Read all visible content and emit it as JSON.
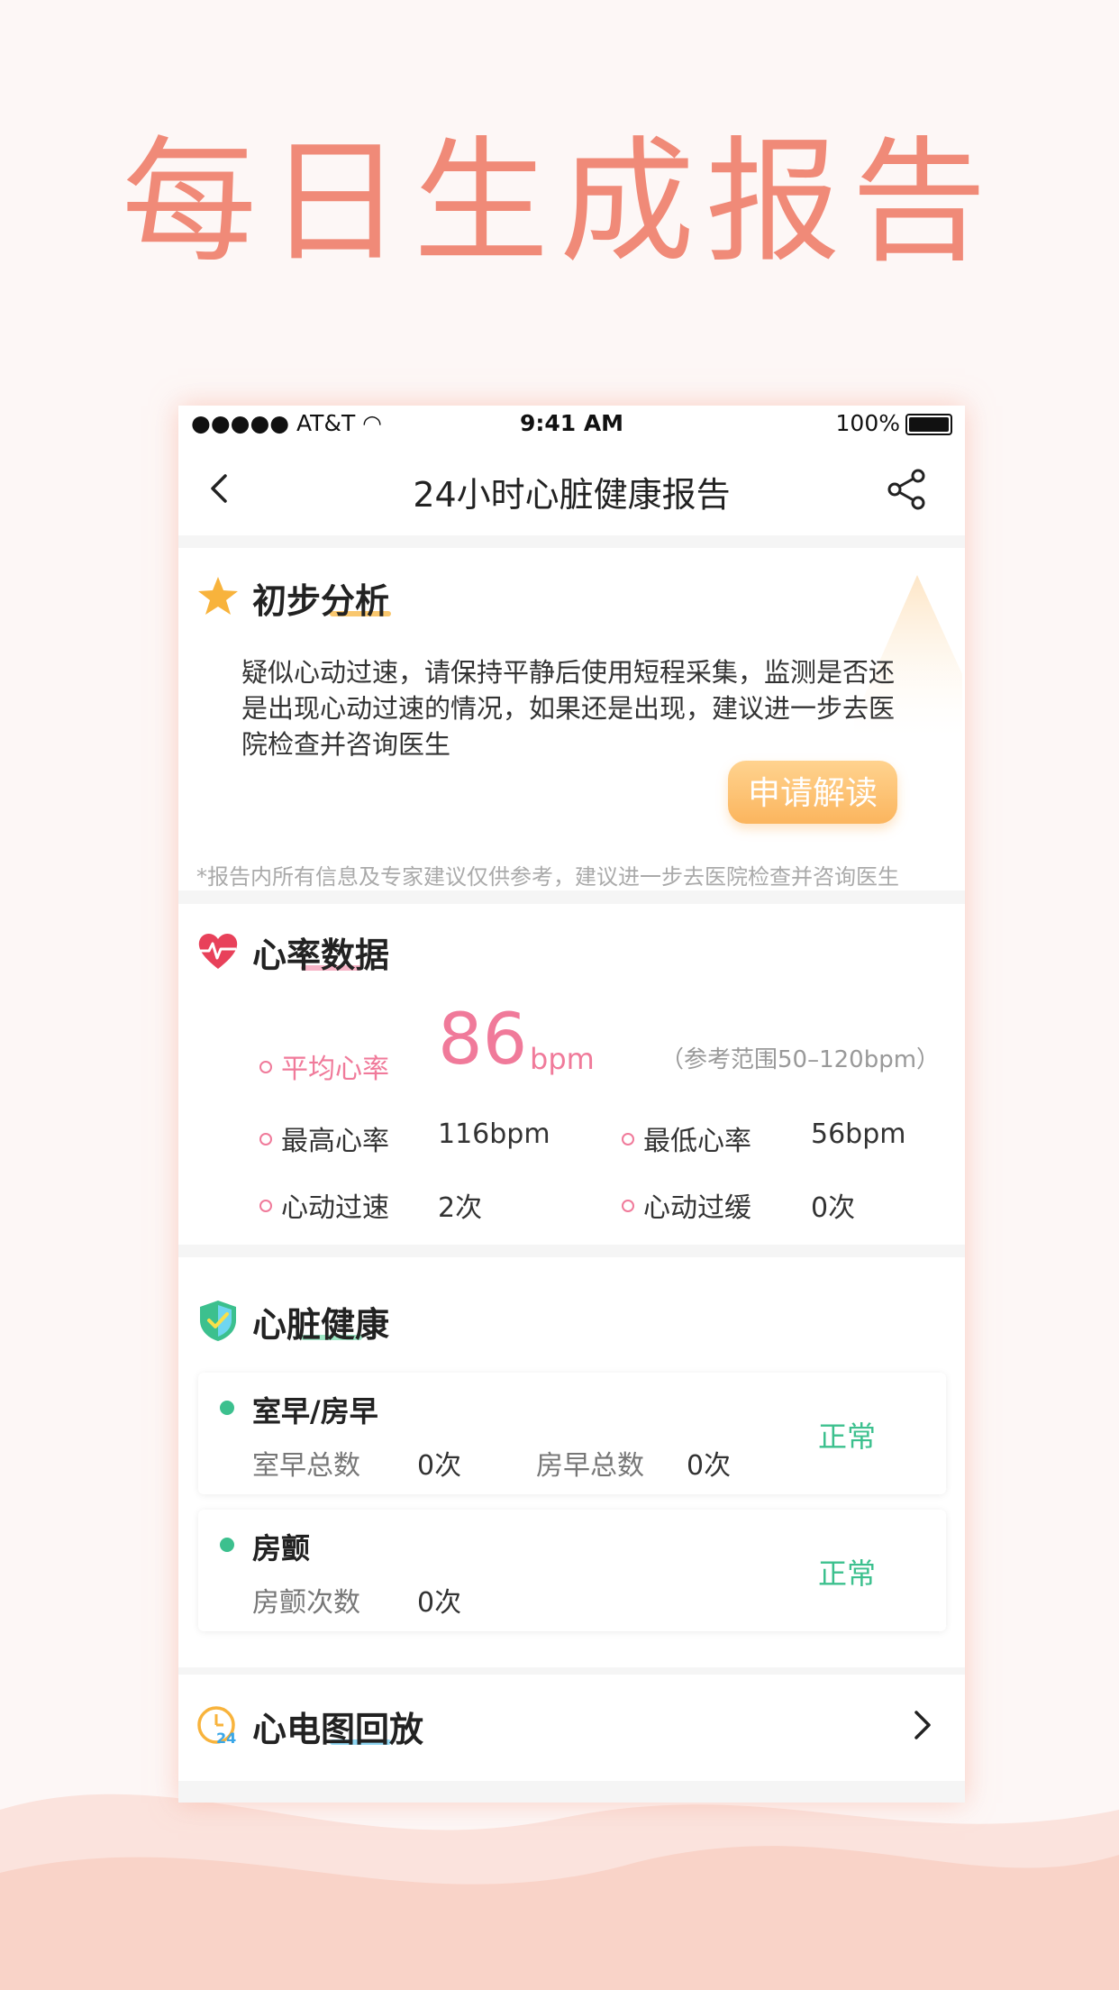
{
  "headline": "每日生成报告",
  "status_bar": {
    "carrier": "●●●●● AT&T",
    "time": "9:41 AM",
    "battery": "100%"
  },
  "nav": {
    "title": "24小时心脏健康报告",
    "back_icon": "chevron-left-icon",
    "share_icon": "share-icon"
  },
  "analysis": {
    "title": "初步分析",
    "text": "疑似心动过速，请保持平静后使用短程采集，监测是否还是出现心动过速的情况，如果还是出现，建议进一步去医院检查并咨询医生",
    "button": "申请解读",
    "disclaimer": "*报告内所有信息及专家建议仅供参考，建议进一步去医院检查并咨询医生",
    "accent_color": "#fbb55e"
  },
  "heart_rate": {
    "title": "心率数据",
    "avg_label": "平均心率",
    "avg_value": "86",
    "avg_unit": "bpm",
    "ref_range": "（参考范围50–120bpm）",
    "max_label": "最高心率",
    "max_value": "116bpm",
    "min_label": "最低心率",
    "min_value": "56bpm",
    "tachy_label": "心动过速",
    "tachy_value": "2次",
    "brady_label": "心动过缓",
    "brady_value": "0次",
    "accent_color": "#f07a9a"
  },
  "heart_health": {
    "title": "心脏健康",
    "items": [
      {
        "title": "室早/房早",
        "status": "正常",
        "metrics": [
          {
            "label": "室早总数",
            "value": "0次"
          },
          {
            "label": "房早总数",
            "value": "0次"
          }
        ]
      },
      {
        "title": "房颤",
        "status": "正常",
        "metrics": [
          {
            "label": "房颤次数",
            "value": "0次"
          }
        ]
      }
    ],
    "status_color": "#3cc08e"
  },
  "ecg": {
    "title": "心电图回放",
    "icon": "clock-24-icon",
    "chevron": "chevron-right-icon"
  }
}
